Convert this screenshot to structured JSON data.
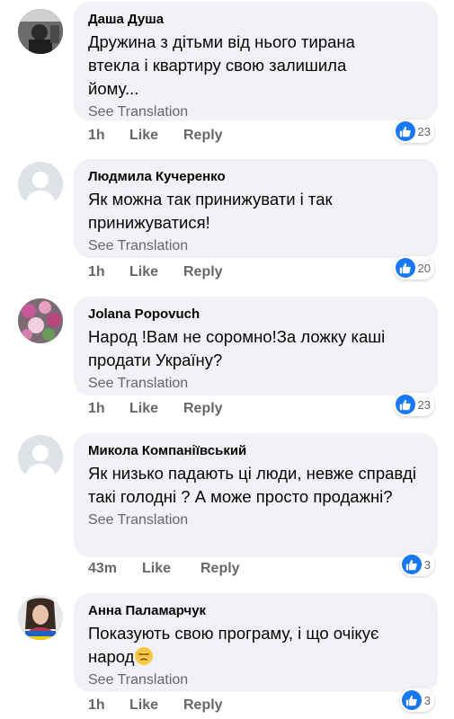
{
  "see_translation": "See Translation",
  "like_label": "Like",
  "reply_label": "Reply",
  "comments": [
    {
      "author": "Даша Душа",
      "text": "Дружина з дітьми від нього тирана втекла і квартиру свою залишила йому...",
      "time": "1h",
      "reactions": "23",
      "avatar": "photo-avatar-dark"
    },
    {
      "author": "Людмила Кучеренко",
      "text": "Як можна так принижувати і так принижуватися!",
      "time": "1h",
      "reactions": "20",
      "avatar": "default-avatar"
    },
    {
      "author": "Jolana Popovuch",
      "text": "Народ !Вам не соромно!За ложку каші продати Україну?",
      "time": "1h",
      "reactions": "23",
      "avatar": "photo-avatar-flowers"
    },
    {
      "author": "Микола Компаніївський",
      "text": "Як низько падають ці люди, невже справді такі голодні ? А може просто продажні?",
      "time": "43m",
      "reactions": "3",
      "avatar": "default-avatar"
    },
    {
      "author": "Анна Паламарчук",
      "text": "Показують свою програму, і що очікує народ",
      "time": "1h",
      "reactions": "3",
      "avatar": "photo-avatar-woman"
    }
  ],
  "colors": {
    "bubble": "#f0f2f5",
    "secondary_text": "#65676b",
    "like_blue": "#1877f2"
  }
}
